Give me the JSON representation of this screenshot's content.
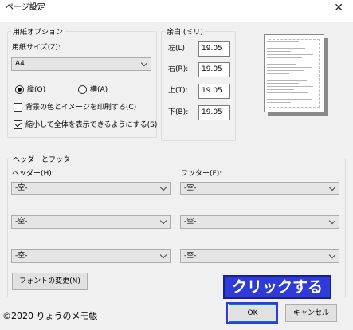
{
  "window": {
    "title": "ページ設定"
  },
  "paper": {
    "group_label": "用紙オプション",
    "size_label": "用紙サイズ(Z):",
    "size_value": "A4",
    "portrait_label": "縦(O)",
    "landscape_label": "横(A)",
    "orientation": "portrait",
    "bg_print_label": "背景の色とイメージを印刷する(C)",
    "bg_print_checked": false,
    "shrink_label": "縮小して全体を表示できるようにする(S)",
    "shrink_checked": true
  },
  "margins": {
    "group_label": "余白 (ミリ)",
    "left_label": "左(L):",
    "left_value": "19.05",
    "right_label": "右(R):",
    "right_value": "19.05",
    "top_label": "上(T):",
    "top_value": "19.05",
    "bottom_label": "下(B):",
    "bottom_value": "19.05"
  },
  "header_footer": {
    "group_label": "ヘッダーとフッター",
    "header_label": "ヘッダー(H):",
    "footer_label": "フッター(F):",
    "header_values": [
      "-空-",
      "-空-",
      "-空-"
    ],
    "footer_values": [
      "-空-",
      "-空-",
      "-空-"
    ],
    "font_button": "フォントの変更(N)"
  },
  "buttons": {
    "ok": "OK",
    "cancel": "キャンセル"
  },
  "annotation": {
    "text": "クリックする",
    "color": "#2e3bd6"
  },
  "watermark": "©2020 りょうのメモ帳",
  "icons": {
    "close": "close-icon",
    "chevron": "chevron-down-icon"
  }
}
